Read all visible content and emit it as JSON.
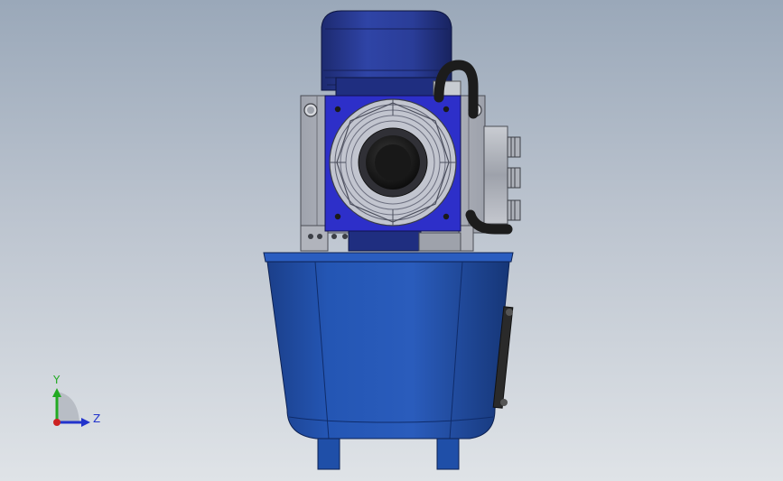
{
  "viewport": {
    "background_top": "#9aa8b9",
    "background_bottom": "#dfe3e7"
  },
  "model": {
    "motor_color": "#2a3e9e",
    "fan_cover_color": "#2d2fc9",
    "tank_color": "#1f4fa8",
    "bracket_color": "#b9bcc4",
    "hose_color": "#1c1c1c"
  },
  "triad": {
    "y_label": "Y",
    "z_label": "Z",
    "y_color": "#22aa22",
    "z_color": "#2233cc",
    "x_color": "#cc2222"
  }
}
